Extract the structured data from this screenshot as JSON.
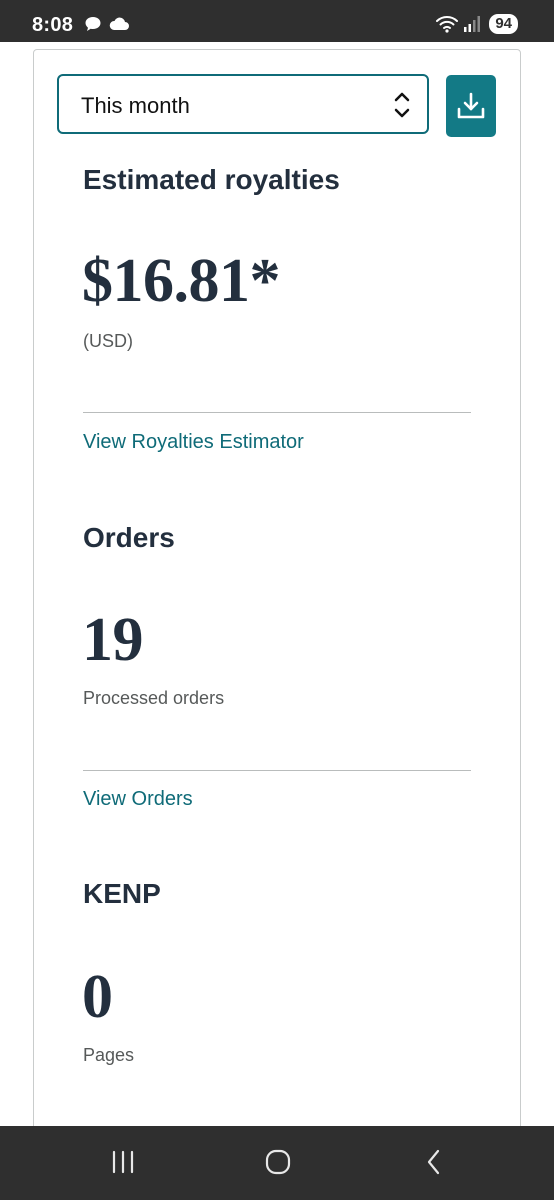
{
  "status_bar": {
    "time": "8:08",
    "battery": "94",
    "icons": [
      "chat-bubble-icon",
      "cloud-icon",
      "wifi-icon",
      "signal-icon"
    ]
  },
  "filter": {
    "selected_period": "This month",
    "download_icon": "download-icon"
  },
  "royalties": {
    "title": "Estimated royalties",
    "amount": "$16.81*",
    "currency": "(USD)",
    "link": "View Royalties Estimator"
  },
  "orders": {
    "title": "Orders",
    "count": "19",
    "label": "Processed orders",
    "link": "View Orders"
  },
  "kenp": {
    "title": "KENP",
    "count": "0",
    "label": "Pages"
  },
  "nav": {
    "icons": [
      "recent-apps-icon",
      "home-icon",
      "back-icon"
    ]
  },
  "colors": {
    "accent": "#137a86",
    "text": "#232f3e",
    "muted": "#565959",
    "system_bar": "#2f2f2f"
  }
}
